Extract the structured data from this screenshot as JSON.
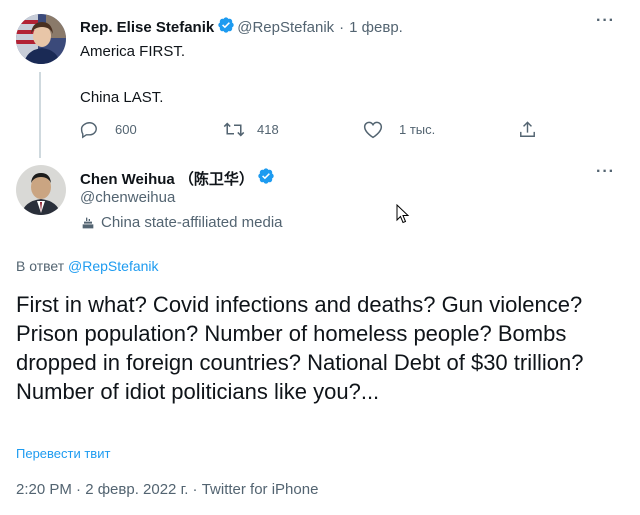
{
  "tweet1": {
    "name": "Rep. Elise Stefanik",
    "handle": "@RepStefanik",
    "separator": "·",
    "date": "1 февр.",
    "line1": "America FIRST.",
    "line2": "China LAST.",
    "actions": {
      "reply_count": "600",
      "retweet_count": "418",
      "like_count": "1 тыс."
    }
  },
  "tweet2": {
    "name": "Chen Weihua （陈卫华）",
    "handle": "@chenweihua",
    "label": "China state-affiliated media",
    "reply_prefix": "В ответ",
    "reply_handle": "@RepStefanik",
    "text": "First in what? Covid infections and deaths? Gun violence? Prison population? Number of homeless people? Bombs dropped in foreign countries? National Debt of $30 trillion? Number of idiot politicians like you?...",
    "translate": "Перевести твит",
    "meta": "2:20 PM · 2 февр. 2022 г. · Twitter for iPhone"
  },
  "colors": {
    "accent": "#1d9bf0",
    "muted": "#536471",
    "text": "#0f1419",
    "thread_line": "#cfd9de"
  },
  "icons": [
    "more-icon",
    "verified-badge-icon",
    "reply-icon",
    "retweet-icon",
    "like-icon",
    "share-icon",
    "state-media-icon",
    "cursor-icon"
  ]
}
